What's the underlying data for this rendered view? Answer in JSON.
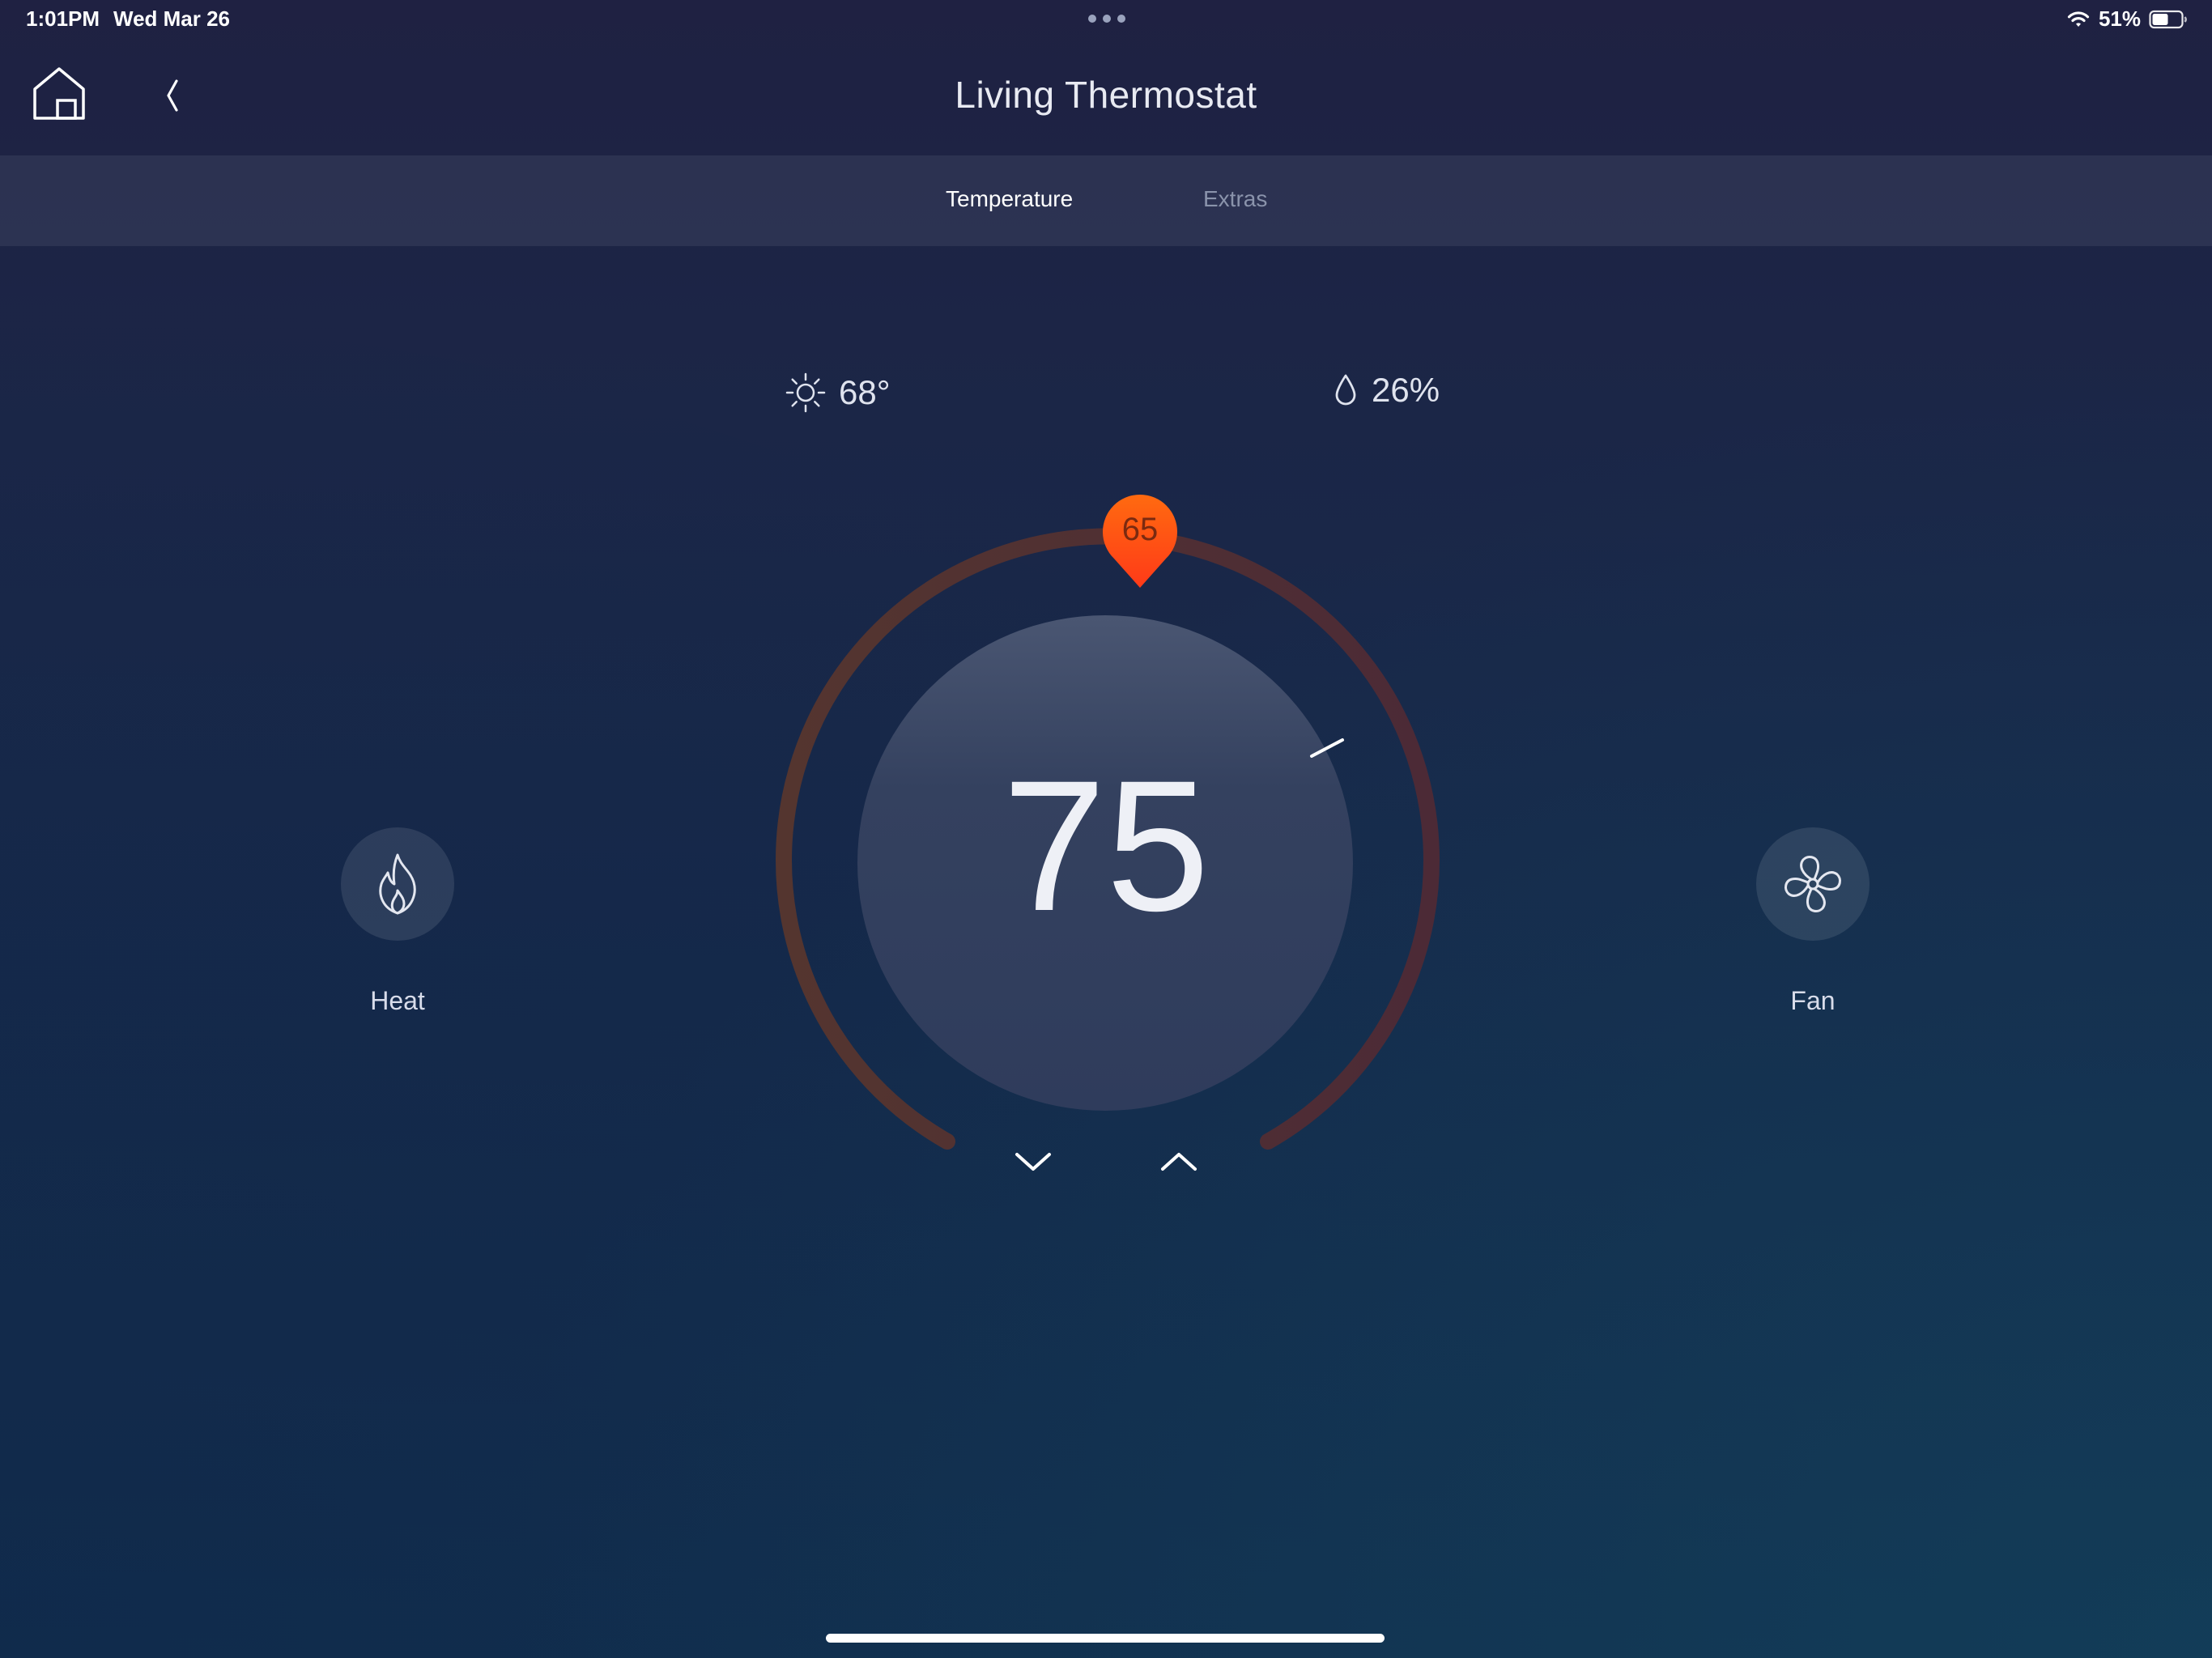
{
  "status_bar": {
    "time": "1:01PM",
    "date": "Wed Mar 26",
    "battery": "51%",
    "icons": [
      "wifi-icon",
      "battery-icon"
    ]
  },
  "header": {
    "title": "Living Thermostat",
    "icons": [
      "home-icon",
      "chevron-left-icon"
    ]
  },
  "tabs": [
    {
      "label": "Temperature",
      "active": true
    },
    {
      "label": "Extras",
      "active": false
    }
  ],
  "readouts": {
    "outdoor_temp": "68°",
    "outdoor_icon": "sun-icon",
    "humidity": "26%",
    "humidity_icon": "droplet-icon"
  },
  "thermostat": {
    "current_temp": "75",
    "setpoint": "65",
    "setpoint_color": "#ff4a14",
    "arc_color": "#4e2c38",
    "step_icons": [
      "chevron-down-icon",
      "chevron-up-icon"
    ]
  },
  "modes": {
    "heat": {
      "label": "Heat",
      "icon": "flame-icon"
    },
    "fan": {
      "label": "Fan",
      "icon": "fan-icon"
    }
  },
  "colors": {
    "accent": "#ff4a14",
    "background_top": "#1f2142",
    "background_bottom": "#11304f"
  }
}
